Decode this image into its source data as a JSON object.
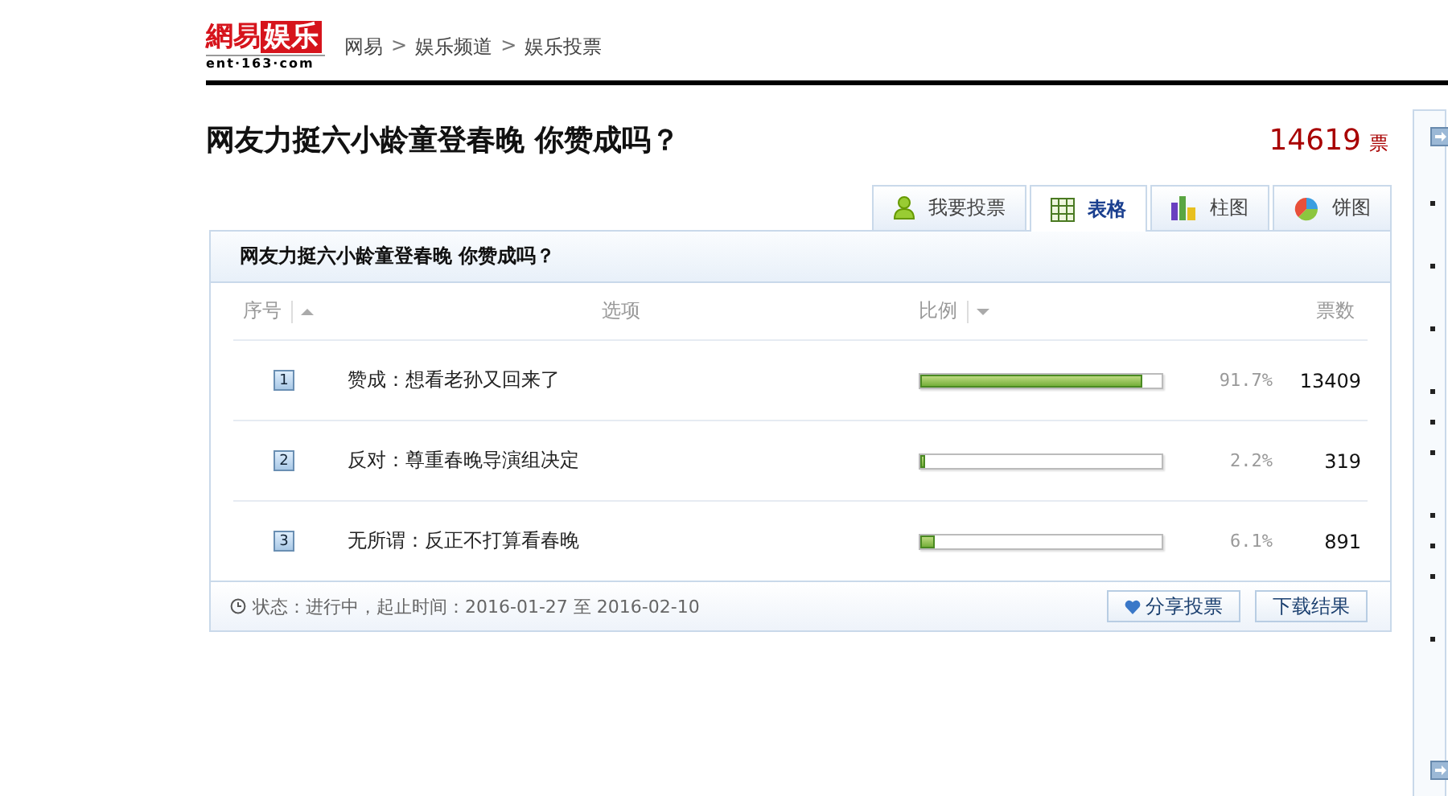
{
  "logo": {
    "brand": "網易",
    "channel": "娱乐",
    "domain": "ent·163·com"
  },
  "breadcrumb": [
    {
      "kind": "link",
      "label": "网易"
    },
    {
      "kind": "separator",
      "label": ">"
    },
    {
      "kind": "link",
      "label": "娱乐频道"
    },
    {
      "kind": "separator",
      "label": ">"
    },
    {
      "kind": "link",
      "label": "娱乐投票"
    }
  ],
  "title": "网友力挺六小龄童登春晚 你赞成吗？",
  "total": {
    "count": "14619",
    "unit": "票"
  },
  "tabs": [
    {
      "label": "我要投票",
      "kind": "person",
      "selected": false
    },
    {
      "label": "表格",
      "kind": "table",
      "selected": true
    },
    {
      "label": "柱图",
      "kind": "bars",
      "selected": false
    },
    {
      "label": "饼图",
      "kind": "pie",
      "selected": false
    }
  ],
  "panel": {
    "title": "网友力挺六小龄童登春晚 你赞成吗？",
    "columns": [
      {
        "label": "序号",
        "sortable": true,
        "ascending": true
      },
      {
        "label": "选项",
        "sortable": false
      },
      {
        "label": "比例",
        "sortable": true,
        "ascending": false
      },
      {
        "label": "票数",
        "sortable": false
      }
    ],
    "rows": [
      {
        "index": "1",
        "option": "赞成：想看老孙又回来了",
        "level": 0.917,
        "percent": "91.7%",
        "votes": "13409"
      },
      {
        "index": "2",
        "option": "反对：尊重春晚导演组决定",
        "level": 0.022,
        "percent": "2.2%",
        "votes": "319"
      },
      {
        "index": "3",
        "option": "无所谓：反正不打算看春晚",
        "level": 0.061,
        "percent": "6.1%",
        "votes": "891"
      }
    ],
    "status": "状态：进行中，起止时间：2016-01-27 至 2016-02-10",
    "buttons": [
      {
        "label": "分享投票",
        "kind": "share"
      },
      {
        "label": "下载结果",
        "kind": "plain"
      }
    ]
  }
}
